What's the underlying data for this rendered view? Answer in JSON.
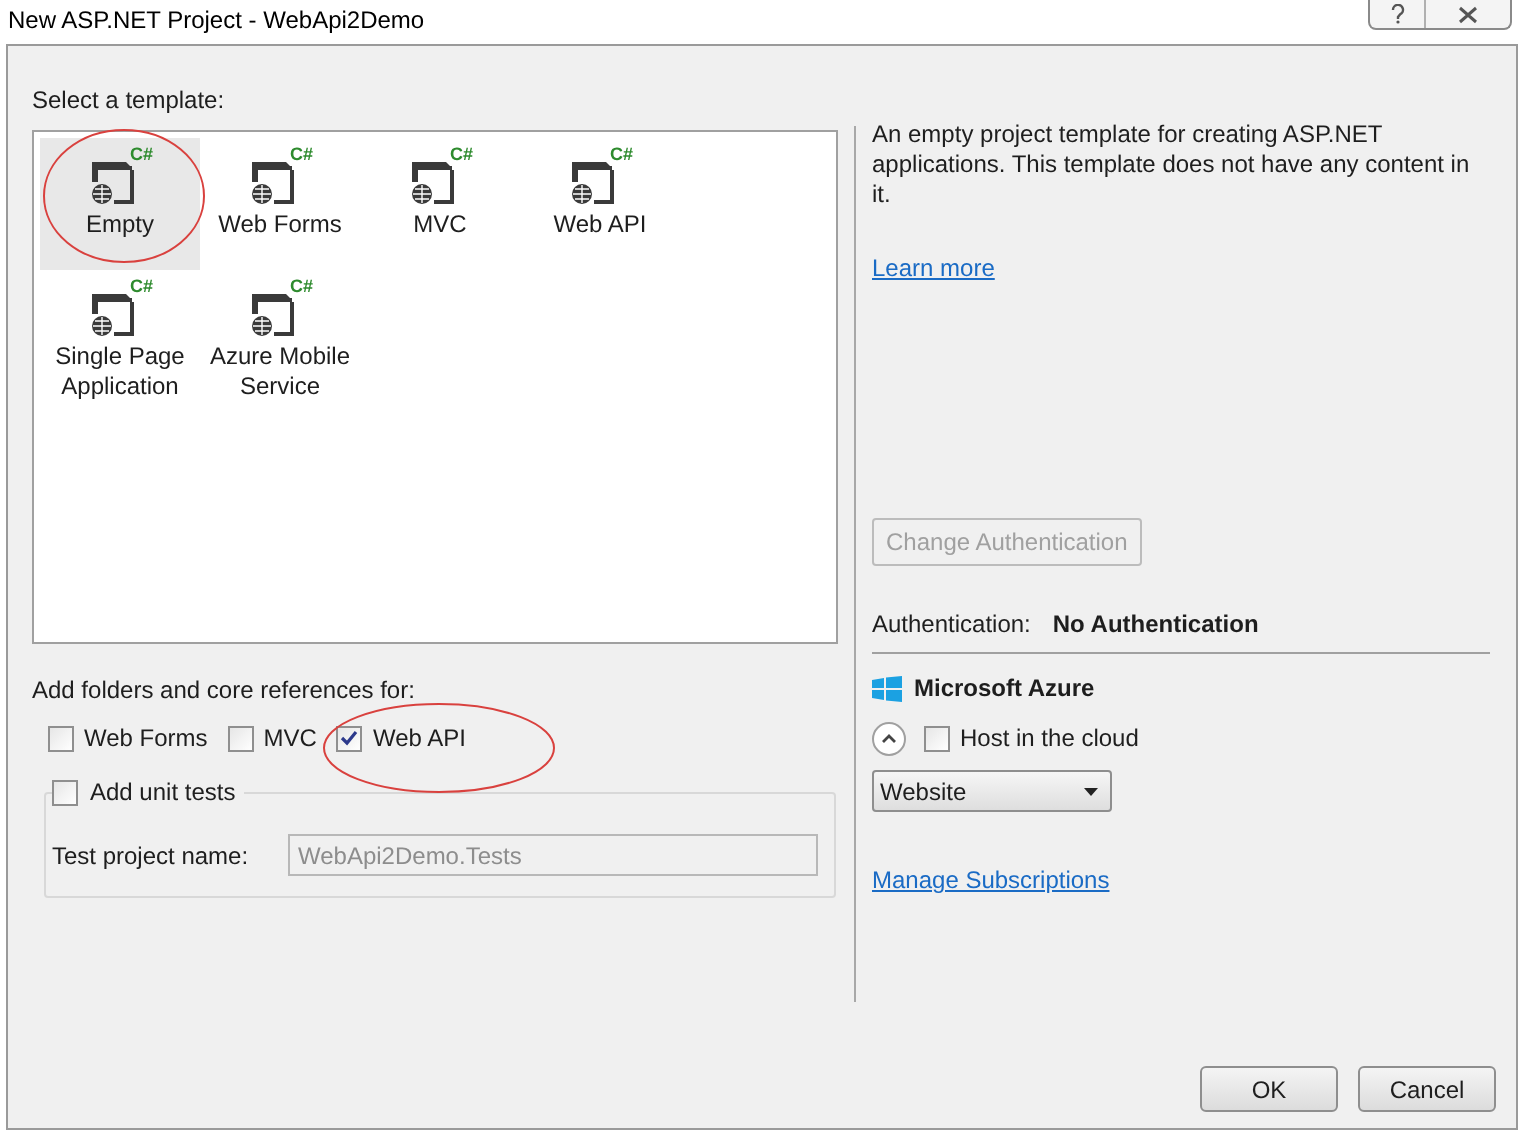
{
  "window": {
    "title": "New ASP.NET Project - WebApi2Demo"
  },
  "template_section": {
    "label": "Select a template:",
    "templates": [
      {
        "label": "Empty",
        "badge": "C#",
        "selected": true
      },
      {
        "label": "Web Forms",
        "badge": "C#",
        "selected": false
      },
      {
        "label": "MVC",
        "badge": "C#",
        "selected": false
      },
      {
        "label": "Web API",
        "badge": "C#",
        "selected": false
      },
      {
        "label": "Single Page Application",
        "badge": "C#",
        "selected": false
      },
      {
        "label": "Azure Mobile Service",
        "badge": "C#",
        "selected": false
      }
    ]
  },
  "folders": {
    "label": "Add folders and core references for:",
    "options": [
      {
        "label": "Web Forms",
        "checked": false
      },
      {
        "label": "MVC",
        "checked": false
      },
      {
        "label": "Web API",
        "checked": true
      }
    ]
  },
  "unit_tests": {
    "label": "Add unit tests",
    "checked": false,
    "project_name_label": "Test project name:",
    "project_name": "WebApi2Demo.Tests"
  },
  "description": {
    "text": "An empty project template for creating ASP.NET applications. This template does not have any content in it.",
    "link": "Learn more"
  },
  "authentication": {
    "button": "Change Authentication",
    "label": "Authentication:",
    "value": "No Authentication"
  },
  "azure": {
    "title": "Microsoft Azure",
    "host_label": "Host in the cloud",
    "host_checked": false,
    "service": "Website",
    "link": "Manage Subscriptions"
  },
  "buttons": [
    "OK",
    "Cancel"
  ]
}
